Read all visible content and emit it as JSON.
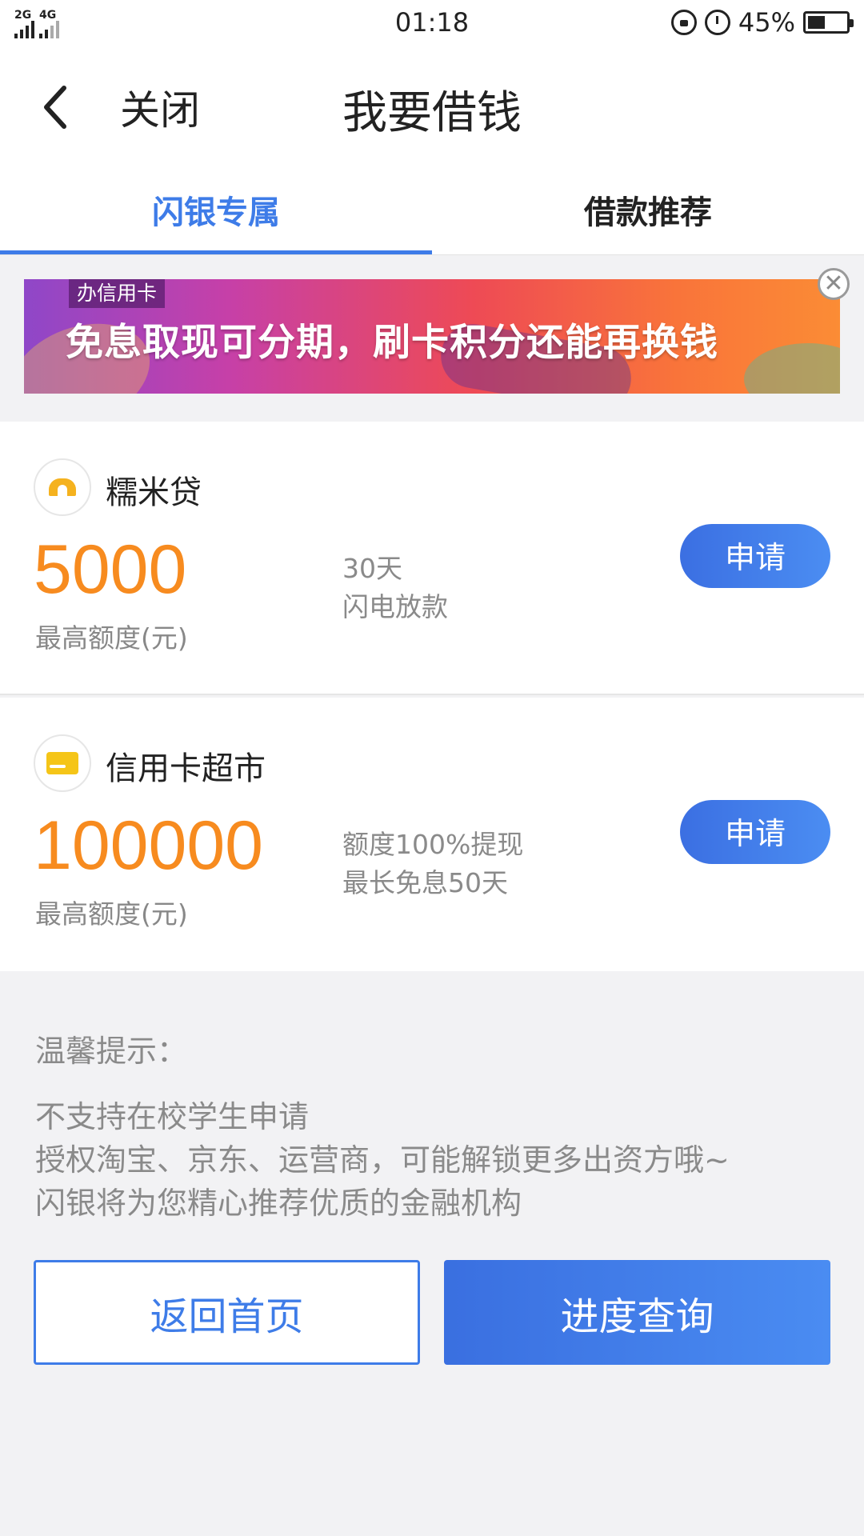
{
  "status_bar": {
    "network_1": "2G",
    "network_2": "4G",
    "time": "01:18",
    "battery": "45%",
    "battery_level": 0.45
  },
  "header": {
    "close_label": "关闭",
    "title": "我要借钱"
  },
  "tabs": [
    {
      "label": "闪银专属",
      "active": true
    },
    {
      "label": "借款推荐",
      "active": false
    }
  ],
  "banner": {
    "tag": "办信用卡",
    "text": "免息取现可分期，刷卡积分还能再换钱",
    "close_icon": "close-circle-icon"
  },
  "loans": [
    {
      "name": "糯米贷",
      "amount": "5000",
      "amount_label": "最高额度(元)",
      "feature_1": "30天",
      "feature_2": "闪电放款",
      "apply_label": "申请"
    },
    {
      "name": "信用卡超市",
      "amount": "100000",
      "amount_label": "最高额度(元)",
      "feature_1": "额度100%提现",
      "feature_2": "最长免息50天",
      "apply_label": "申请"
    }
  ],
  "tips": {
    "title": "温馨提示：",
    "lines": [
      "不支持在校学生申请",
      "授权淘宝、京东、运营商，可能解锁更多出资方哦~",
      "闪银将为您精心推荐优质的金融机构"
    ]
  },
  "actions": {
    "home_label": "返回首页",
    "progress_label": "进度查询"
  },
  "colors": {
    "accent": "#3e7ce8",
    "amount": "#f78b1f"
  }
}
